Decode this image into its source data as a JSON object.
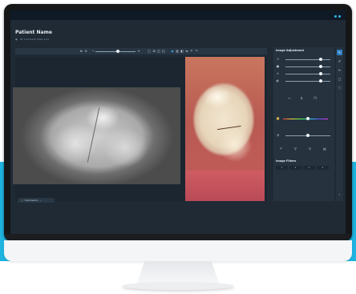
{
  "app": {
    "title": "Patient Name",
    "subtitle_icon": "camera-icon",
    "subtitle_text": "ID: Comment 2022-1-01"
  },
  "toolbar": {
    "icons": [
      "zoom-in-icon",
      "zoom-out-icon",
      "zoom-minus-icon",
      "zoom-plus-icon",
      "layout-single-icon",
      "layout-grid-icon",
      "layout-split-icon",
      "rotate-icon",
      "fit-icon",
      "columns-icon",
      "compare-icon",
      "swap-icon",
      "undo-icon",
      "redo-icon"
    ],
    "zoom_level": 0.55
  },
  "viewer": {
    "comments_label": "Comments"
  },
  "panel": {
    "title": "Image Adjustment",
    "sliders": [
      {
        "icon": "brightness-icon",
        "level": 0.78
      },
      {
        "icon": "contrast-icon",
        "level": 0.78
      },
      {
        "icon": "gamma-icon",
        "level": 0.78
      },
      {
        "icon": "sharpness-icon",
        "level": 0.78
      }
    ],
    "tools": [
      "flip-icon",
      "crop-icon",
      "copy-icon"
    ],
    "color_level": 0.55,
    "extra_slider_level": 0.5,
    "actions": [
      "reset-icon",
      "stamp-icon",
      "stamp-alt-icon",
      "save-icon"
    ],
    "filters_title": "Image Filters",
    "filters": [
      "1",
      "2",
      "3",
      "4"
    ]
  },
  "rail": {
    "icons": [
      "pen-icon",
      "brush-icon",
      "pencil-icon",
      "square-icon",
      "info-icon"
    ]
  },
  "colors": {
    "accent": "#2fb5e6",
    "screen_bg": "#1f2a35",
    "panel_bg": "#26333f"
  }
}
